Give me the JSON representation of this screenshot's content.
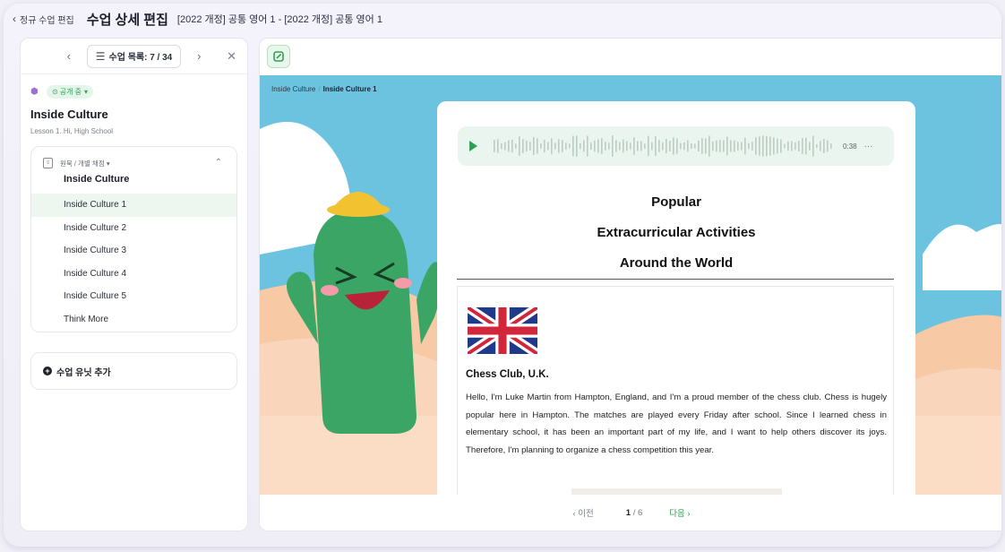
{
  "header": {
    "back_label": "정규 수업 편집",
    "title": "수업 상세 편집",
    "breadcrumb": "[2022 개정] 공통 영어 1 - [2022 개정] 공통 영어 1"
  },
  "sidebar": {
    "list_label": "수업 목록: 7 / 34",
    "status": "공개 중",
    "lesson_title": "Inside Culture",
    "lesson_subtitle": "Lesson 1. Hi, High School",
    "unit_mode": "원묵 / 개별 채점",
    "unit_name": "Inside Culture",
    "items": [
      {
        "label": "Inside Culture 1",
        "active": true
      },
      {
        "label": "Inside Culture 2",
        "active": false
      },
      {
        "label": "Inside Culture 3",
        "active": false
      },
      {
        "label": "Inside Culture 4",
        "active": false
      },
      {
        "label": "Inside Culture 5",
        "active": false
      },
      {
        "label": "Think More",
        "active": false
      }
    ],
    "add_unit_label": "수업 유닛 추가"
  },
  "stage": {
    "crumb_parent": "Inside Culture",
    "crumb_current": "Inside Culture 1"
  },
  "audio": {
    "time": "0:38",
    "more": "···"
  },
  "article": {
    "title_line1": "Popular",
    "title_line2": "Extracurricular Activities",
    "title_line3": "Around the World",
    "club_title": "Chess Club, U.K.",
    "body": "Hello, I'm Luke Martin from Hampton, England, and I'm a proud member of the chess club. Chess is hugely popular here in Hampton. The matches are played every Friday after school. Since I learned chess in elementary school, it has been an important part of my life, and I want to help others discover its joys. Therefore, I'm planning to organize a chess competition this year."
  },
  "pager": {
    "prev": "이전",
    "current": "1",
    "total": "/ 6",
    "next": "다음"
  },
  "colors": {
    "accent_green": "#2f9f55",
    "sky": "#6bc3df",
    "cactus": "#3aa564"
  }
}
